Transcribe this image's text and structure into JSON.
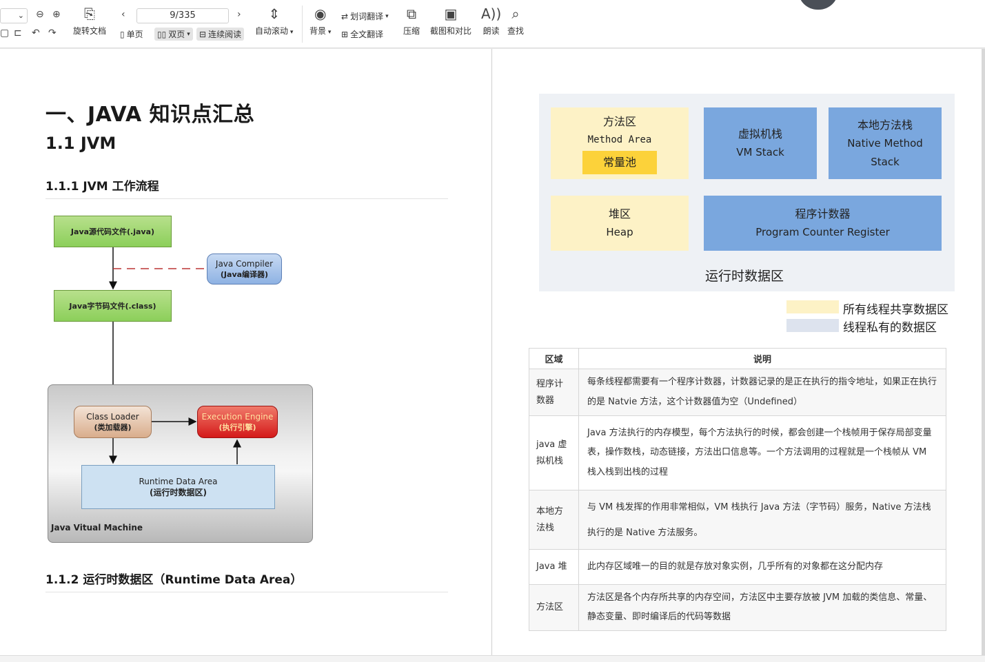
{
  "toolbar": {
    "page_indicator": "9/335",
    "rotate_label": "旋转文档",
    "single_page": "单页",
    "double_page": "双页",
    "continuous": "连续阅读",
    "auto_scroll": "自动滚动",
    "background": "背景",
    "word_translate": "划词翻译",
    "full_translate": "全文翻译",
    "compress": "压缩",
    "screenshot_compare": "截图和对比",
    "read_aloud": "朗读",
    "find": "查找"
  },
  "left_page": {
    "h1": "一、JAVA 知识点汇总",
    "h2": "1.1 JVM",
    "h3_workflow": "1.1.1 JVM  工作流程",
    "h3_runtime": "1.1.2  运行时数据区（Runtime Data Area）",
    "diagram": {
      "source_file": "Java源代码文件(.java)",
      "compiler_line1": "Java Compiler",
      "compiler_line2": "(Java编译器)",
      "bytecode_file": "Java字节码文件(.class)",
      "class_loader_line1": "Class Loader",
      "class_loader_line2": "(类加载器)",
      "exec_engine_line1": "Execution Engine",
      "exec_engine_line2": "(执行引擎)",
      "runtime_line1": "Runtime  Data  Area",
      "runtime_line2": "(运行时数据区)",
      "jvm_label": "Java Vitual Machine"
    }
  },
  "right_page": {
    "runtime_diagram": {
      "method_area_cn": "方法区",
      "method_area_en": "Method  Area",
      "const_pool": "常量池",
      "vm_stack_cn": "虚拟机栈",
      "vm_stack_en": "VM Stack",
      "native_stack_cn": "本地方法栈",
      "native_stack_en1": "Native Method",
      "native_stack_en2": "Stack",
      "heap_cn": "堆区",
      "heap_en": "Heap",
      "pc_cn": "程序计数器",
      "pc_en": "Program Counter Register",
      "caption": "运行时数据区",
      "legend_shared": "所有线程共享数据区",
      "legend_private": "线程私有的数据区",
      "color_shared": "#fdf2c6",
      "color_private": "#dde3ee"
    },
    "table": {
      "headers": [
        "区域",
        "说明"
      ],
      "rows": [
        {
          "area": "程序计数器",
          "desc": "每条线程都需要有一个程序计数器，计数器记录的是正在执行的指令地址，如果正在执行的是 Natvie 方法，这个计数器值为空（Undefined）"
        },
        {
          "area": "java 虚拟机栈",
          "desc": "Java 方法执行的内存模型，每个方法执行的时候，都会创建一个栈帧用于保存局部变量表，操作数栈，动态链接，方法出口信息等。一个方法调用的过程就是一个栈帧从 VM 栈入栈到出栈的过程"
        },
        {
          "area": "本地方法栈",
          "desc": "与 VM 栈发挥的作用非常相似，VM 栈执行 Java 方法（字节码）服务，Native 方法栈执行的是 Native 方法服务。"
        },
        {
          "area": "Java 堆",
          "desc": "此内存区域唯一的目的就是存放对象实例，几乎所有的对象都在这分配内存"
        },
        {
          "area": "方法区",
          "desc": "方法区是各个内存所共享的内存空间，方法区中主要存放被 JVM 加载的类信息、常量、静态变量、即时编译后的代码等数据"
        }
      ]
    }
  }
}
